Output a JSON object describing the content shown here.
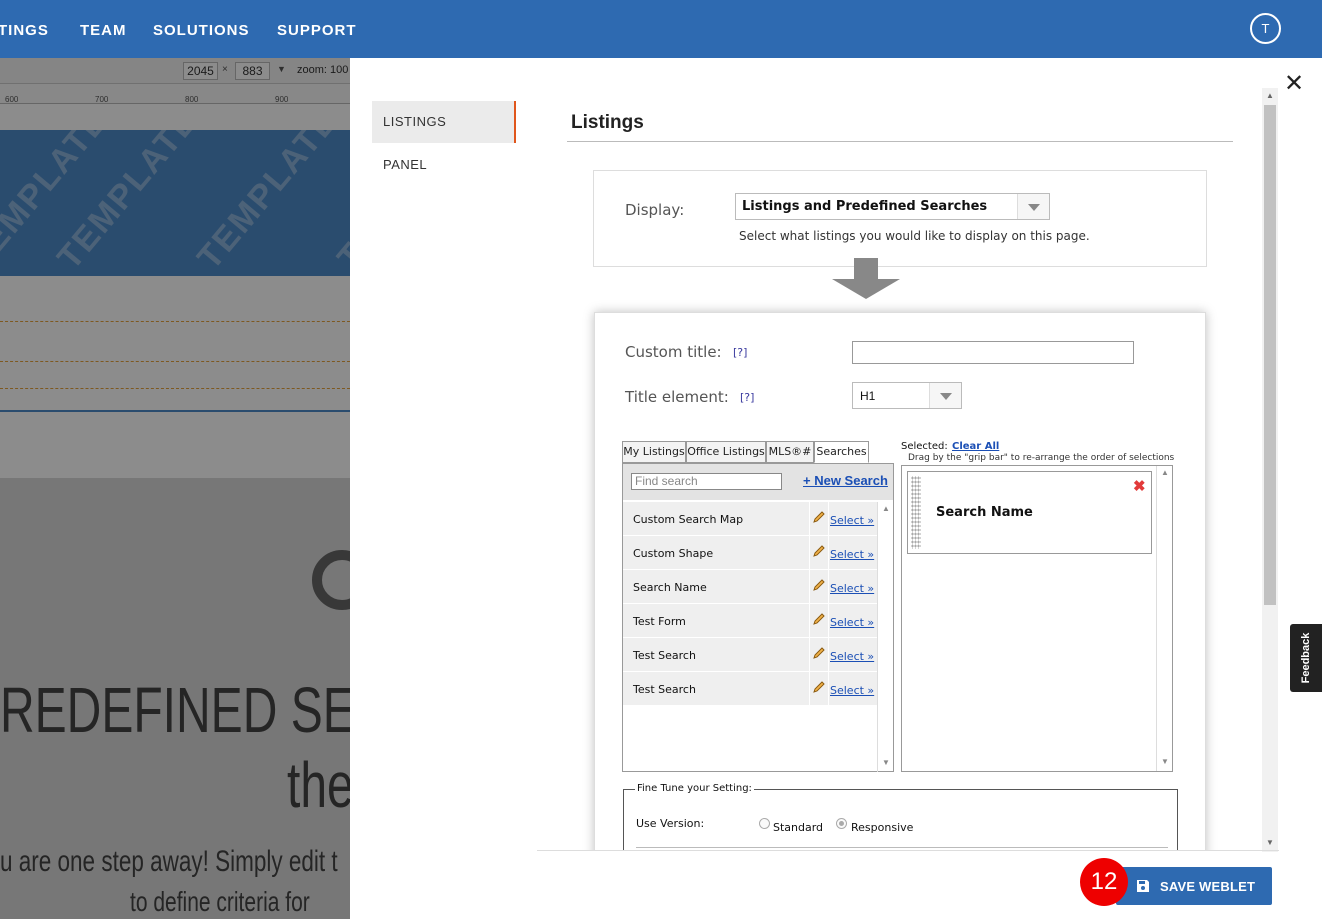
{
  "topnav": {
    "items": [
      "TINGS",
      "TEAM",
      "SOLUTIONS",
      "SUPPORT"
    ],
    "avatar_initial": "T"
  },
  "background": {
    "width_value": "2045",
    "times": "×",
    "height_value": "883",
    "zoom": "zoom: 100",
    "ruler_ticks": [
      "600",
      "700",
      "800",
      "900"
    ],
    "watermark": "TEMPLATE",
    "big_heading_1": "REDEFINED SEAR",
    "big_heading_2": "the",
    "sub_text_1": "u are one step away! Simply edit t",
    "sub_text_2": "to define criteria for"
  },
  "modal": {
    "close_glyph": "✕",
    "side_tabs": [
      {
        "label": "LISTINGS",
        "active": true
      },
      {
        "label": "PANEL",
        "active": false
      }
    ],
    "section_title": "Listings",
    "display": {
      "label": "Display:",
      "value": "Listings and Predefined Searches",
      "help": "Select what listings you would like to display on this page."
    },
    "custom_title": {
      "label": "Custom title:",
      "help": "[?]",
      "value": ""
    },
    "title_element": {
      "label": "Title element:",
      "help": "[?]",
      "value": "H1"
    },
    "tabs": [
      "My Listings",
      "Office Listings",
      "MLS®#",
      "Searches"
    ],
    "active_tab": "Searches",
    "find_placeholder": "Find search",
    "new_search": "+ New Search",
    "searches": [
      {
        "name": "Custom Search Map",
        "select": "Select »"
      },
      {
        "name": "Custom Shape",
        "select": "Select »"
      },
      {
        "name": "Search Name",
        "select": "Select »"
      },
      {
        "name": "Test Form",
        "select": "Select »"
      },
      {
        "name": "Test Search",
        "select": "Select »"
      },
      {
        "name": "Test Search",
        "select": "Select »"
      }
    ],
    "selected_label": "Selected:",
    "clear_all": "Clear All",
    "drag_help": "Drag by the \"grip bar\" to re-arrange the order of selections",
    "selected_items": [
      {
        "name": "Search Name"
      }
    ],
    "fine_tune": {
      "legend": "Fine Tune your Setting:",
      "use_version_label": "Use Version:",
      "options": [
        {
          "label": "Standard",
          "checked": false
        },
        {
          "label": "Responsive",
          "checked": true
        }
      ]
    },
    "save_button": "SAVE WEBLET",
    "step_badge": "12"
  },
  "feedback": "Feedback",
  "colors": {
    "nav": "#2e6ab1",
    "accent": "#e0561c",
    "badge": "#ee0000",
    "link": "#1b4fb5"
  }
}
